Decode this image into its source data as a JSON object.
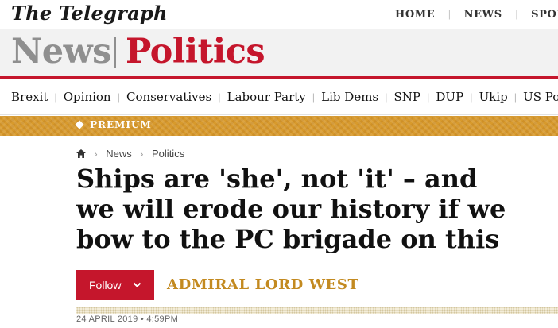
{
  "masthead": {
    "logo_text": "The Telegraph"
  },
  "top_nav": {
    "items": [
      "HOME",
      "NEWS",
      "SPORT"
    ]
  },
  "section": {
    "parent": "News",
    "current": "Politics"
  },
  "sub_nav": {
    "items": [
      "Brexit",
      "Opinion",
      "Conservatives",
      "Labour Party",
      "Lib Dems",
      "SNP",
      "DUP",
      "Ukip",
      "US Pol"
    ]
  },
  "premium_banner": {
    "label": "PREMIUM",
    "color": "#d89a2c"
  },
  "breadcrumb": {
    "items": [
      "News",
      "Politics"
    ],
    "home_icon": "house-icon"
  },
  "article": {
    "headline": "Ships are 'she', not 'it' – and we will erode our history if we bow to the PC brigade on this",
    "follow_label": "Follow",
    "author": "ADMIRAL LORD WEST",
    "timestamp": "24 APRIL 2019 • 4:59PM"
  },
  "colors": {
    "accent": "#c5162c",
    "author": "#c38a20"
  }
}
